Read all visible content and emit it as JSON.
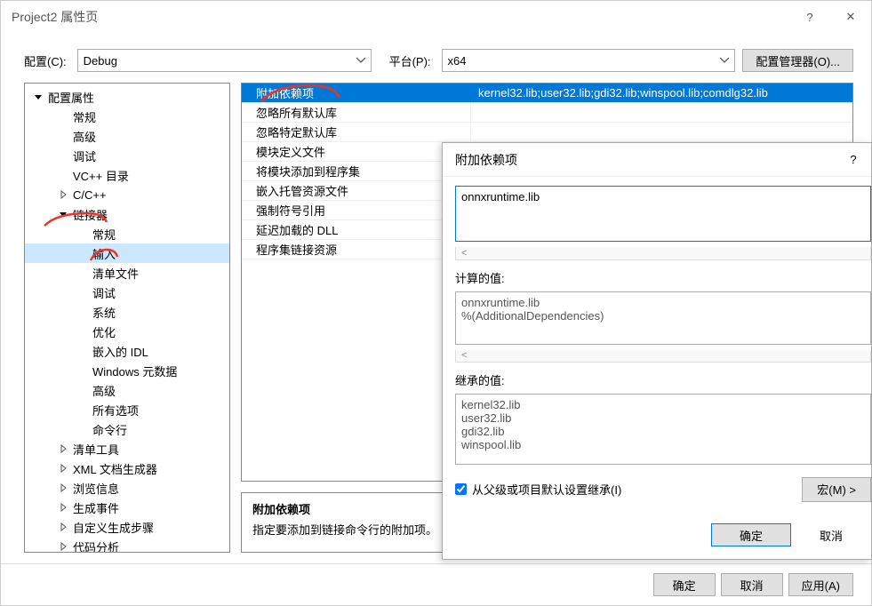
{
  "window": {
    "title": "Project2 属性页",
    "help": "?",
    "close": "✕"
  },
  "toolbar": {
    "config_label": "配置(C):",
    "config_value": "Debug",
    "platform_label": "平台(P):",
    "platform_value": "x64",
    "manager": "配置管理器(O)..."
  },
  "tree": [
    {
      "label": "配置属性",
      "depth": 0,
      "expand": "▾"
    },
    {
      "label": "常规",
      "depth": 1
    },
    {
      "label": "高级",
      "depth": 1
    },
    {
      "label": "调试",
      "depth": 1
    },
    {
      "label": "VC++ 目录",
      "depth": 1
    },
    {
      "label": "C/C++",
      "depth": 1,
      "expand": "▸"
    },
    {
      "label": "链接器",
      "depth": 1,
      "expand": "▾",
      "mark": true
    },
    {
      "label": "常规",
      "depth": 2
    },
    {
      "label": "输入",
      "depth": 2,
      "sel": true,
      "mark": true
    },
    {
      "label": "清单文件",
      "depth": 2
    },
    {
      "label": "调试",
      "depth": 2
    },
    {
      "label": "系统",
      "depth": 2
    },
    {
      "label": "优化",
      "depth": 2
    },
    {
      "label": "嵌入的 IDL",
      "depth": 2
    },
    {
      "label": "Windows 元数据",
      "depth": 2
    },
    {
      "label": "高级",
      "depth": 2
    },
    {
      "label": "所有选项",
      "depth": 2
    },
    {
      "label": "命令行",
      "depth": 2
    },
    {
      "label": "清单工具",
      "depth": 1,
      "expand": "▸"
    },
    {
      "label": "XML 文档生成器",
      "depth": 1,
      "expand": "▸"
    },
    {
      "label": "浏览信息",
      "depth": 1,
      "expand": "▸"
    },
    {
      "label": "生成事件",
      "depth": 1,
      "expand": "▸"
    },
    {
      "label": "自定义生成步骤",
      "depth": 1,
      "expand": "▸"
    },
    {
      "label": "代码分析",
      "depth": 1,
      "expand": "▸"
    }
  ],
  "props": [
    {
      "name": "附加依赖项",
      "value": "kernel32.lib;user32.lib;gdi32.lib;winspool.lib;comdlg32.lib",
      "sel": true,
      "mark": true
    },
    {
      "name": "忽略所有默认库",
      "value": ""
    },
    {
      "name": "忽略特定默认库",
      "value": ""
    },
    {
      "name": "模块定义文件",
      "value": ""
    },
    {
      "name": "将模块添加到程序集",
      "value": ""
    },
    {
      "name": "嵌入托管资源文件",
      "value": ""
    },
    {
      "name": "强制符号引用",
      "value": ""
    },
    {
      "name": "延迟加载的 DLL",
      "value": ""
    },
    {
      "name": "程序集链接资源",
      "value": ""
    }
  ],
  "desc": {
    "title": "附加依赖项",
    "text": "指定要添加到链接命令行的附加项。"
  },
  "footer": {
    "ok": "确定",
    "cancel": "取消",
    "apply": "应用(A)"
  },
  "dialog": {
    "title": "附加依赖项",
    "help": "?",
    "input_value": "onnxruntime.lib",
    "computed_label": "计算的值:",
    "computed_value": "onnxruntime.lib\n%(AdditionalDependencies)",
    "inherited_label": "继承的值:",
    "inherited_value": "kernel32.lib\nuser32.lib\ngdi32.lib\nwinspool.lib",
    "inherit_checkbox": "从父级或项目默认设置继承(I)",
    "macro": "宏(M) >",
    "ok": "确定",
    "cancel": "取消"
  }
}
